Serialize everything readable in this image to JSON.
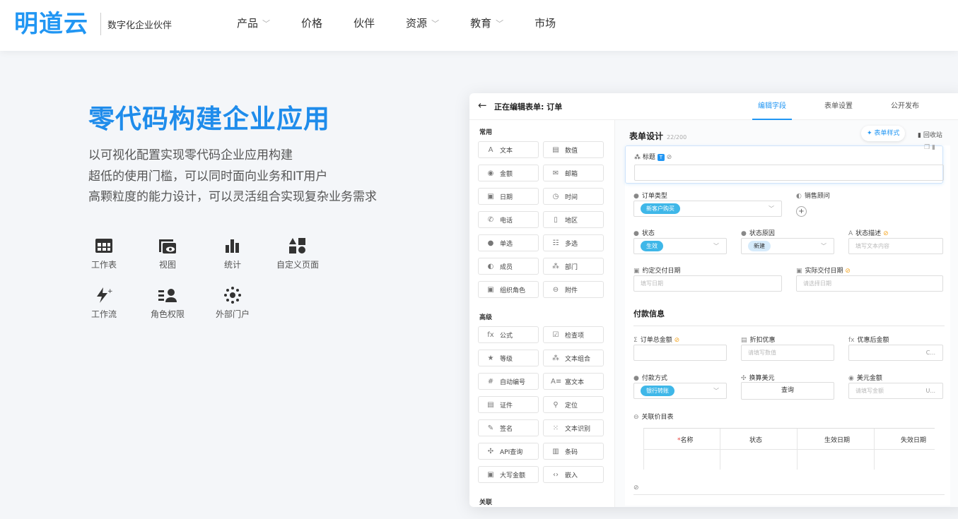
{
  "header": {
    "logo": "明道云",
    "tagline": "数字化企业伙伴",
    "nav": [
      {
        "label": "产品",
        "dropdown": true
      },
      {
        "label": "价格",
        "dropdown": false
      },
      {
        "label": "伙伴",
        "dropdown": false
      },
      {
        "label": "资源",
        "dropdown": true
      },
      {
        "label": "教育",
        "dropdown": true
      },
      {
        "label": "市场",
        "dropdown": false
      }
    ]
  },
  "hero": {
    "title": "零代码构建企业应用",
    "lines": [
      "以可视化配置实现零代码企业应用构建",
      "超低的使用门槛，可以同时面向业务和IT用户",
      "高颗粒度的能力设计，可以灵活组合实现复杂业务需求"
    ],
    "features": [
      {
        "label": "工作表",
        "icon": "grid-icon"
      },
      {
        "label": "视图",
        "icon": "view-icon"
      },
      {
        "label": "统计",
        "icon": "bar-chart-icon"
      },
      {
        "label": "自定义页面",
        "icon": "custom-page-icon"
      },
      {
        "label": "工作流",
        "icon": "workflow-icon"
      },
      {
        "label": "角色权限",
        "icon": "role-icon"
      },
      {
        "label": "外部门户",
        "icon": "portal-icon"
      }
    ]
  },
  "colors": {
    "accent": "#1f8ceb",
    "pill": "#3fb7e8",
    "warn": "#f5a623"
  },
  "app": {
    "edit_title": "正在编辑表单: 订单",
    "tabs": [
      "编辑字段",
      "表单设置",
      "公开发布"
    ],
    "palette": {
      "common_title": "常用",
      "common": [
        [
          "A",
          "文本"
        ],
        [
          "▤",
          "数值"
        ],
        [
          "◉",
          "金额"
        ],
        [
          "✉",
          "邮箱"
        ],
        [
          "▣",
          "日期"
        ],
        [
          "◷",
          "时间"
        ],
        [
          "✆",
          "电话"
        ],
        [
          "▯",
          "地区"
        ],
        [
          "●",
          "单选"
        ],
        [
          "☷",
          "多选"
        ],
        [
          "◐",
          "成员"
        ],
        [
          "⁂",
          "部门"
        ],
        [
          "▣",
          "组织角色"
        ],
        [
          "⊖",
          "附件"
        ]
      ],
      "advanced_title": "高级",
      "advanced": [
        [
          "fx",
          "公式"
        ],
        [
          "☑",
          "检查项"
        ],
        [
          "★",
          "等级"
        ],
        [
          "⁂",
          "文本组合"
        ],
        [
          "#",
          "自动编号"
        ],
        [
          "A≡",
          "富文本"
        ],
        [
          "▤",
          "证件"
        ],
        [
          "⚲",
          "定位"
        ],
        [
          "✎",
          "签名"
        ],
        [
          "⁙",
          "文本识别"
        ],
        [
          "✣",
          "API查询"
        ],
        [
          "▥",
          "条码"
        ],
        [
          "▣",
          "大写金额"
        ],
        [
          "‹›",
          "嵌入"
        ]
      ],
      "relation_title": "关联"
    },
    "canvas": {
      "title": "表单设计",
      "count": "22/200",
      "style_btn": "表单样式",
      "recycle": "回收站",
      "title_field": "标题",
      "order_type": {
        "label": "订单类型",
        "value": "新客户购买"
      },
      "sales": {
        "label": "销售顾问"
      },
      "status": {
        "label": "状态",
        "value": "生效"
      },
      "status_reason": {
        "label": "状态原因",
        "value": "新建"
      },
      "status_desc": {
        "label": "状态描述",
        "placeholder": "填写文本内容"
      },
      "delivery_date": {
        "label": "约定交付日期",
        "placeholder": "填写日期"
      },
      "actual_date": {
        "label": "实际交付日期",
        "placeholder": "请选择日期"
      },
      "payment_group": "付款信息",
      "total": {
        "label": "订单总金额"
      },
      "discount": {
        "label": "折扣优惠",
        "placeholder": "请填写数值"
      },
      "after_discount": {
        "label": "优惠后金额",
        "suffix": "C..."
      },
      "pay_method": {
        "label": "付款方式",
        "value": "银行转账"
      },
      "convert_usd": {
        "label": "换算美元",
        "button": "查询"
      },
      "usd_amount": {
        "label": "美元金额",
        "placeholder": "请填写金额",
        "suffix": "U..."
      },
      "price_table": {
        "label": "关联价目表",
        "columns": [
          "名称",
          "状态",
          "生效日期",
          "失效日期"
        ]
      }
    }
  }
}
